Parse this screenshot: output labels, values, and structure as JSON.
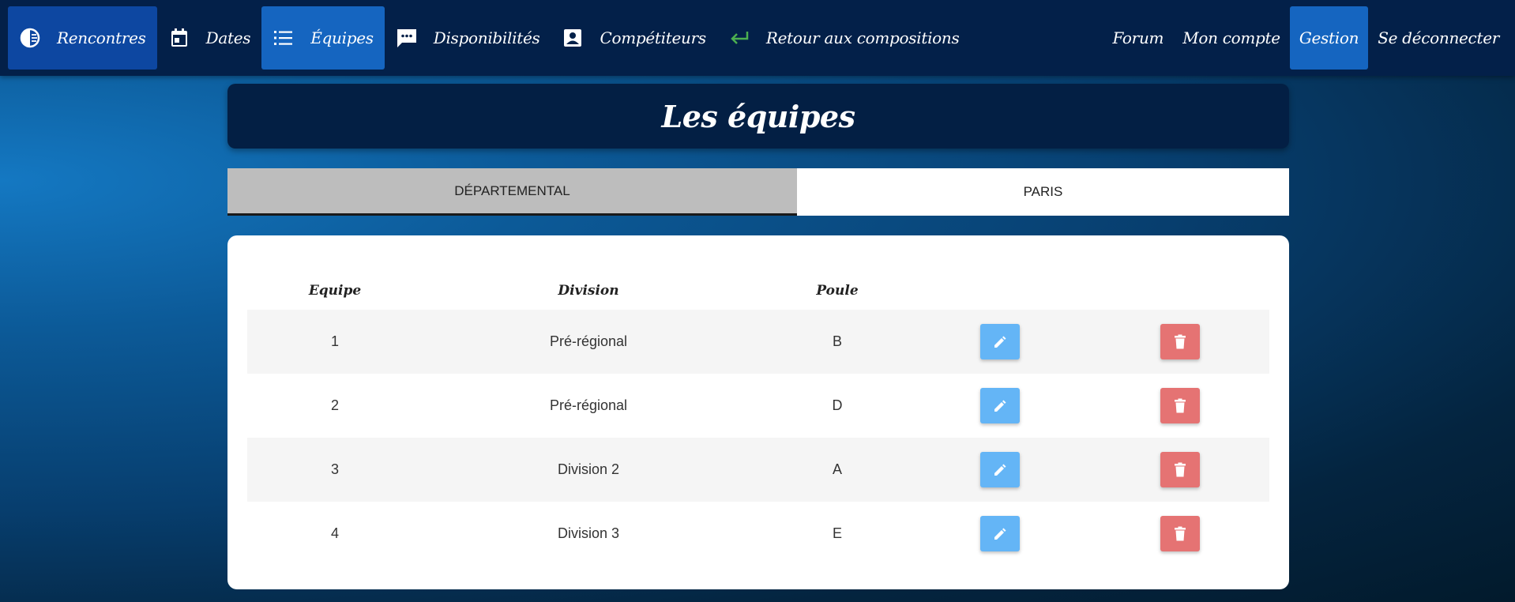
{
  "nav": {
    "left": [
      {
        "label": "Rencontres",
        "icon": "contrast-circle-icon"
      },
      {
        "label": "Dates",
        "icon": "calendar-icon"
      },
      {
        "label": "Équipes",
        "icon": "list-icon"
      },
      {
        "label": "Disponibilités",
        "icon": "chat-icon"
      },
      {
        "label": "Compétiteurs",
        "icon": "contact-card-icon"
      },
      {
        "label": "Retour aux compositions",
        "icon": "return-arrow-icon"
      }
    ],
    "right": [
      {
        "label": "Forum"
      },
      {
        "label": "Mon compte"
      },
      {
        "label": "Gestion"
      },
      {
        "label": "Se déconnecter"
      }
    ]
  },
  "page_title": "Les équipes",
  "tabs": [
    {
      "label": "DÉPARTEMENTAL"
    },
    {
      "label": "PARIS"
    }
  ],
  "table": {
    "headers": [
      "Equipe",
      "Division",
      "Poule"
    ],
    "rows": [
      {
        "equipe": "1",
        "division": "Pré-régional",
        "poule": "B"
      },
      {
        "equipe": "2",
        "division": "Pré-régional",
        "poule": "D"
      },
      {
        "equipe": "3",
        "division": "Division 2",
        "poule": "A"
      },
      {
        "equipe": "4",
        "division": "Division 3",
        "poule": "E"
      }
    ]
  },
  "colors": {
    "navbar": "#032049",
    "active_tab_blue": "#1565c0",
    "edit_button": "#64b5f6",
    "delete_button": "#e57373",
    "return_icon": "#4caf50"
  }
}
